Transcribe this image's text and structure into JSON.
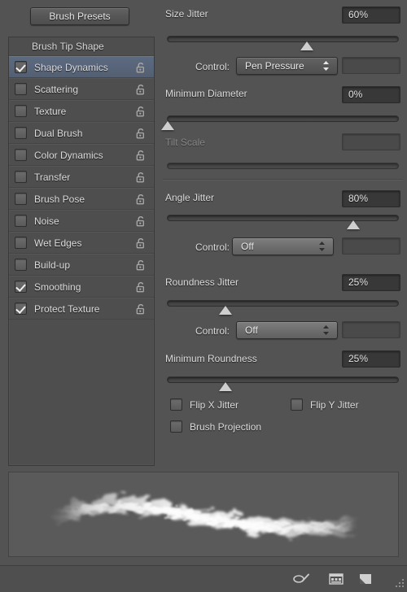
{
  "panel": {
    "presets_button": "Brush Presets",
    "list_header": "Brush Tip Shape"
  },
  "brush_options": [
    {
      "label": "Shape Dynamics",
      "checked": true,
      "selected": true,
      "lock": "unlock-icon"
    },
    {
      "label": "Scattering",
      "checked": false,
      "selected": false,
      "lock": "unlock-icon"
    },
    {
      "label": "Texture",
      "checked": false,
      "selected": false,
      "lock": "unlock-icon"
    },
    {
      "label": "Dual Brush",
      "checked": false,
      "selected": false,
      "lock": "unlock-icon"
    },
    {
      "label": "Color Dynamics",
      "checked": false,
      "selected": false,
      "lock": "unlock-icon"
    },
    {
      "label": "Transfer",
      "checked": false,
      "selected": false,
      "lock": "unlock-icon"
    },
    {
      "label": "Brush Pose",
      "checked": false,
      "selected": false,
      "lock": "unlock-icon"
    },
    {
      "label": "Noise",
      "checked": false,
      "selected": false,
      "lock": "unlock-icon"
    },
    {
      "label": "Wet Edges",
      "checked": false,
      "selected": false,
      "lock": "unlock-icon"
    },
    {
      "label": "Build-up",
      "checked": false,
      "selected": false,
      "lock": "unlock-icon"
    },
    {
      "label": "Smoothing",
      "checked": true,
      "selected": false,
      "lock": "unlock-icon"
    },
    {
      "label": "Protect Texture",
      "checked": true,
      "selected": false,
      "lock": "unlock-icon"
    }
  ],
  "shape_dynamics": {
    "size_jitter": {
      "label": "Size Jitter",
      "value": "60%",
      "slider_percent": 60,
      "control_label": "Control:",
      "control_value": "Pen Pressure",
      "control_extra_value": ""
    },
    "minimum_diameter": {
      "label": "Minimum Diameter",
      "value": "0%",
      "slider_percent": 0
    },
    "tilt_scale": {
      "label": "Tilt Scale",
      "value": "",
      "slider_percent": 0,
      "disabled": true
    },
    "angle_jitter": {
      "label": "Angle Jitter",
      "value": "80%",
      "slider_percent": 80,
      "control_label": "Control:",
      "control_value": "Off",
      "control_extra_value": ""
    },
    "roundness_jitter": {
      "label": "Roundness Jitter",
      "value": "25%",
      "slider_percent": 25,
      "control_label": "Control:",
      "control_value": "Off",
      "control_extra_value": ""
    },
    "minimum_roundness": {
      "label": "Minimum Roundness",
      "value": "25%",
      "slider_percent": 25
    },
    "checkboxes": [
      {
        "label": "Flip X Jitter",
        "checked": false
      },
      {
        "label": "Flip Y Jitter",
        "checked": false
      },
      {
        "label": "Brush Projection",
        "checked": false
      }
    ]
  },
  "footer": {
    "icons": [
      {
        "name": "brush-preset-tool-icon"
      },
      {
        "name": "toggle-brush-panel-icon"
      },
      {
        "name": "new-brush-icon"
      },
      {
        "name": "resize-grip-icon"
      }
    ]
  },
  "colors": {
    "panel_bg": "#535353",
    "list_bg": "#4e4e4e",
    "selection": "#5c6a80",
    "text": "#dcdcdc",
    "text_dim": "#868686",
    "value_field_bg": "#383838",
    "preview_bg": "#5a5a5a"
  }
}
